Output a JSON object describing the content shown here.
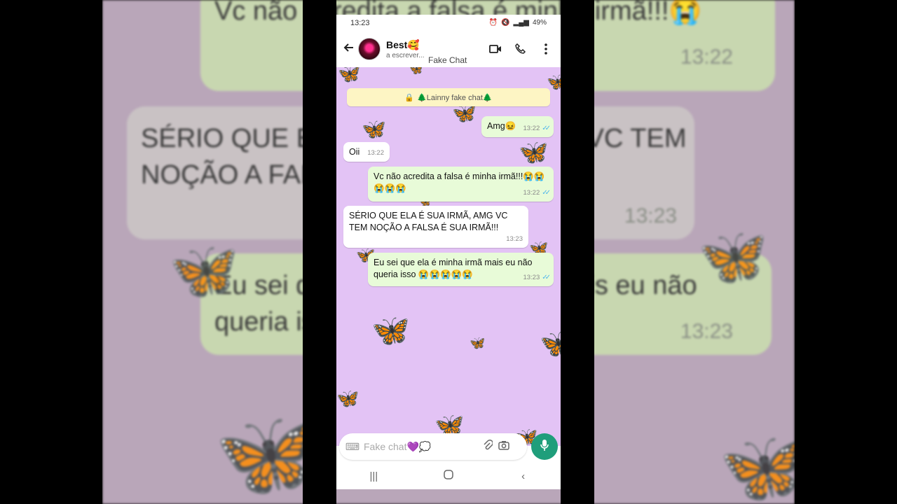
{
  "status_bar": {
    "time": "13:23",
    "battery": "49%"
  },
  "header": {
    "contact_name": "Best🥰",
    "contact_status": "a escrever...",
    "subtitle": "Fake Chat"
  },
  "system_note": {
    "text": "🌲Lainny fake chat🌲"
  },
  "messages": [
    {
      "dir": "out",
      "text": "Amg😖",
      "time": "13:22"
    },
    {
      "dir": "in",
      "text": "Oii",
      "time": "13:22"
    },
    {
      "dir": "out",
      "text": "Vc não acredita a falsa é minha irmã!!!😭😭😭😭😭",
      "time": "13:22"
    },
    {
      "dir": "in",
      "text": "SÉRIO QUE ELA É SUA IRMÃ, AMG VC TEM NOÇÃO A FALSA É SUA IRMÃ!!!",
      "time": "13:23"
    },
    {
      "dir": "out",
      "text": "Eu sei que ela é minha irmã mais eu não queria isso 😭😭😭😭😭",
      "time": "13:23"
    }
  ],
  "input": {
    "placeholder": "Fake chat💜💭"
  },
  "colors": {
    "chat_bg": "#e3c3f5",
    "out_bubble": "#e8fbd8",
    "mic": "#1f9e7b",
    "note": "#fdf5c4"
  },
  "icons": [
    "back-arrow-icon",
    "video-call-icon",
    "phone-icon",
    "more-vert-icon",
    "keyboard-icon",
    "attach-icon",
    "camera-icon",
    "mic-icon",
    "nav-recents-icon",
    "nav-home-icon",
    "nav-back-icon"
  ],
  "background": {
    "msg1_text": "Vc não acredita a falsa é minha irmã!!!😭",
    "msg1_time": "13:22",
    "msg2_text": "SÉRIO QUE ELA É SUA IRMÃ, AMG VC TEM NOÇÃO A FALSA É SUA IRMÃ!!!",
    "msg2_time": "13:23",
    "msg3_text": "Eu sei que ela é minha irmã mais eu não queria isso",
    "msg3_time": "13:23"
  }
}
